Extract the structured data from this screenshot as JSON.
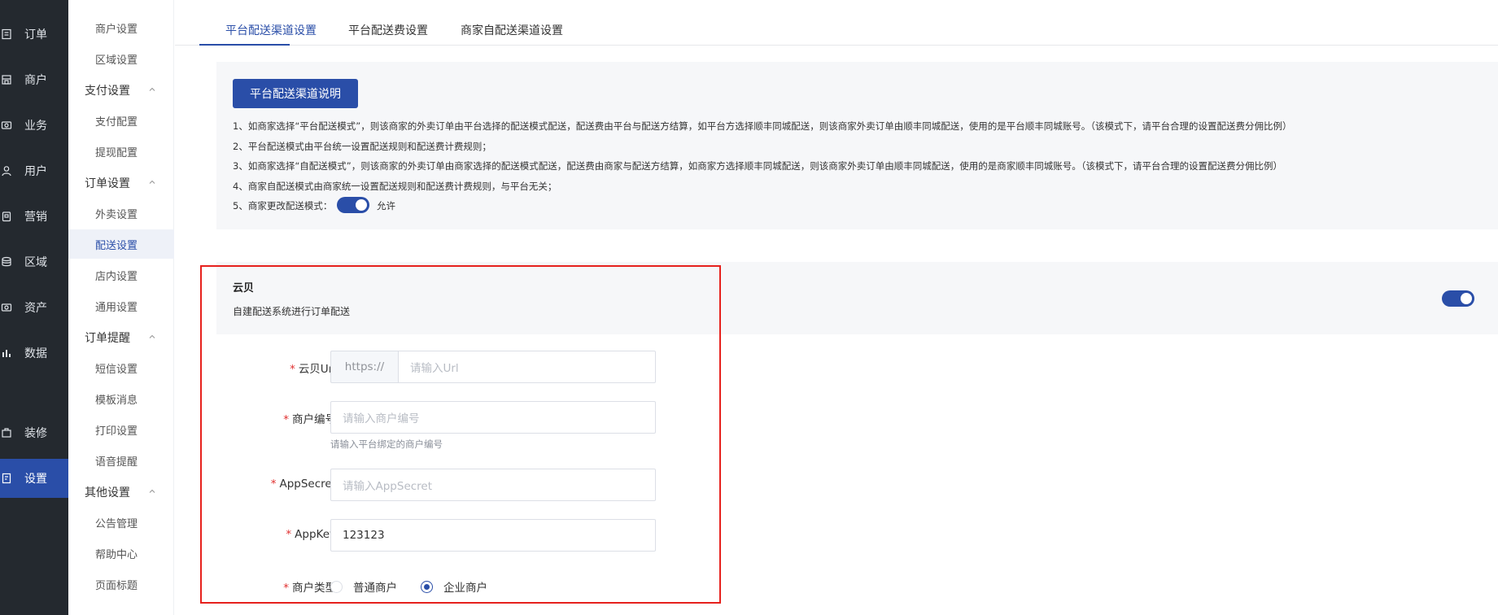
{
  "nav": {
    "items": [
      {
        "label": "订单",
        "icon": "order-icon"
      },
      {
        "label": "商户",
        "icon": "merchant-icon"
      },
      {
        "label": "业务",
        "icon": "business-icon"
      },
      {
        "label": "用户",
        "icon": "user-icon"
      },
      {
        "label": "营销",
        "icon": "marketing-icon"
      },
      {
        "label": "区域",
        "icon": "region-icon"
      },
      {
        "label": "资产",
        "icon": "asset-icon"
      },
      {
        "label": "数据",
        "icon": "chart-icon"
      },
      {
        "label": "装修",
        "icon": "decorate-icon"
      },
      {
        "label": "设置",
        "icon": "settings-icon",
        "active": true
      }
    ]
  },
  "subnav": {
    "items_top": [
      "商户设置",
      "区域设置"
    ],
    "groups": [
      {
        "label": "支付设置",
        "items": [
          "支付配置",
          "提现配置"
        ]
      },
      {
        "label": "订单设置",
        "items": [
          "外卖设置",
          "配送设置"
        ]
      },
      {
        "label": "订单提醒",
        "items": [
          "短信设置",
          "模板消息",
          "打印设置",
          "语音提醒"
        ]
      },
      {
        "label": "其他设置",
        "items": [
          "公告管理",
          "帮助中心",
          "页面标题"
        ]
      }
    ],
    "extra_items": [
      "店内设置",
      "通用设置"
    ],
    "active": "配送设置"
  },
  "tabs": [
    "平台配送渠道设置",
    "平台配送费设置",
    "商家自配送渠道设置"
  ],
  "notice": {
    "button": "平台配送渠道说明",
    "lines": [
      "1、如商家选择“平台配送模式”，则该商家的外卖订单由平台选择的配送模式配送，配送费由平台与配送方结算，如平台方选择顺丰同城配送，则该商家外卖订单由顺丰同城配送，使用的是平台顺丰同城账号。（该模式下，请平台合理的设置配送费分佣比例）",
      "2、平台配送模式由平台统一设置配送规则和配送费计费规则；",
      "3、如商家选择“自配送模式”，则该商家的外卖订单由商家选择的配送模式配送，配送费由商家与配送方结算，如商家方选择顺丰同城配送，则该商家外卖订单由顺丰同城配送，使用的是商家顺丰同城账号。（该模式下，请平台合理的设置配送费分佣比例）",
      "4、商家自配送模式由商家统一设置配送规则和配送费计费规则，与平台无关；",
      "5、商家更改配送模式："
    ],
    "allow_label": "允许",
    "allow_on": true
  },
  "yunbei": {
    "title": "云贝",
    "desc": "自建配送系统进行订单配送",
    "enabled": true,
    "form": {
      "url_label": "云贝Url",
      "url_prefix": "https://",
      "url_placeholder": "请输入Url",
      "merchant_no_label": "商户编号",
      "merchant_no_placeholder": "请输入商户编号",
      "merchant_no_hint": "请输入平台绑定的商户编号",
      "app_secret_label": "AppSecret",
      "app_secret_placeholder": "请输入AppSecret",
      "app_key_label": "AppKey",
      "app_key_value": "123123",
      "merchant_type_label": "商户类型",
      "merchant_type_options": [
        "普通商户",
        "企业商户"
      ],
      "merchant_type_selected": "企业商户"
    }
  },
  "colors": {
    "accent": "#2a4ea8",
    "nav_bg": "#24292f",
    "highlight_box": "#e6211d"
  }
}
